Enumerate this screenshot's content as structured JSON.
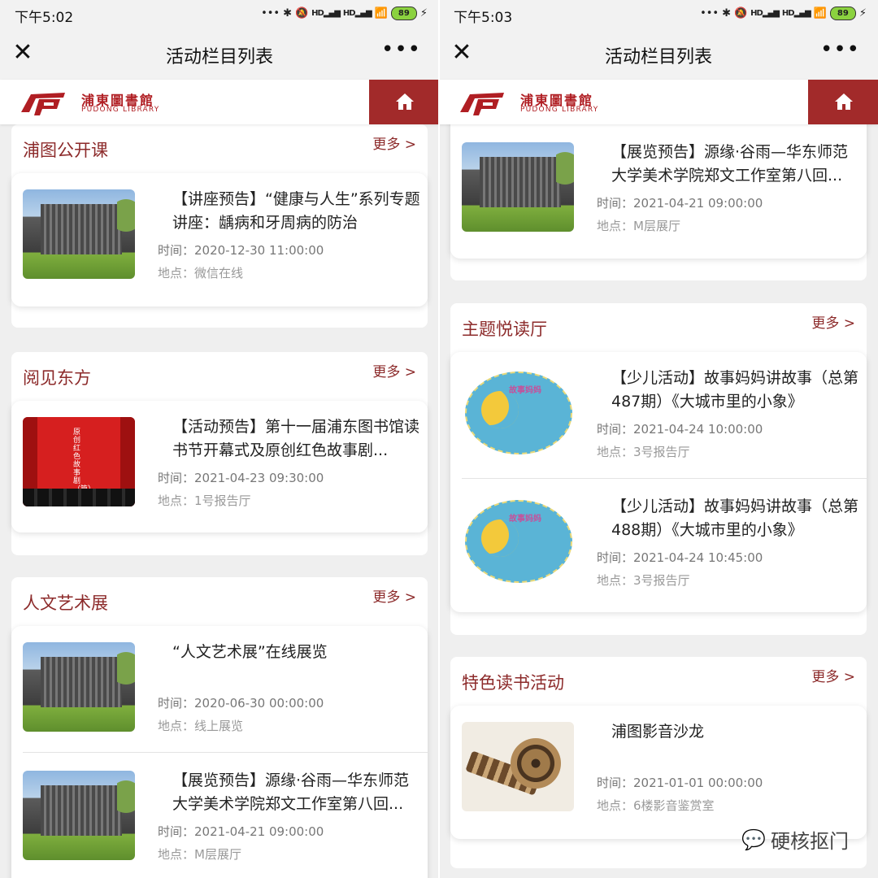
{
  "left": {
    "status": {
      "time": "下午5:02",
      "battery": "89"
    },
    "title": "活动栏目列表",
    "logo_cn": "浦東圖書館",
    "logo_en": "PUDONG LIBRARY",
    "sections": [
      {
        "title": "浦图公开课",
        "more": "更多 >",
        "items": [
          {
            "title": "【讲座预告】“健康与人生”系列专题讲座：龋病和牙周病的防治",
            "time": "时间：2020-12-30 11:00:00",
            "place": "地点：微信在线",
            "thumb": "building"
          }
        ]
      },
      {
        "title": "阅见东方",
        "more": "更多 >",
        "items": [
          {
            "title": "【活动预告】第十一届浦东图书馆读书节开幕式及原创红色故事剧...",
            "time": "时间：2021-04-23 09:30:00",
            "place": "地点：1号报告厅",
            "thumb": "theater"
          }
        ]
      },
      {
        "title": "人文艺术展",
        "more": "更多 >",
        "items": [
          {
            "title": "“人文艺术展”在线展览",
            "time": "时间：2020-06-30 00:00:00",
            "place": "地点：线上展览",
            "thumb": "building"
          },
          {
            "title": "【展览预告】源缘·谷雨—华东师范大学美术学院郑文工作室第八回...",
            "time": "时间：2021-04-21 09:00:00",
            "place": "地点：M层展厅",
            "thumb": "building"
          }
        ]
      }
    ]
  },
  "right": {
    "status": {
      "time": "下午5:03",
      "battery": "89"
    },
    "title": "活动栏目列表",
    "logo_cn": "浦東圖書館",
    "logo_en": "PUDONG LIBRARY",
    "partial_item": {
      "title": "【展览预告】源缘·谷雨—华东师范大学美术学院郑文工作室第八回...",
      "time": "时间：2021-04-21 09:00:00",
      "place": "地点：M层展厅",
      "thumb": "building"
    },
    "sections": [
      {
        "title": "主题悦读厅",
        "more": "更多 >",
        "items": [
          {
            "title": "【少儿活动】故事妈妈讲故事（总第487期）《大城市里的小象》",
            "time": "时间：2021-04-24 10:00:00",
            "place": "地点：3号报告厅",
            "thumb": "story"
          },
          {
            "title": "【少儿活动】故事妈妈讲故事（总第488期）《大城市里的小象》",
            "time": "时间：2021-04-24 10:45:00",
            "place": "地点：3号报告厅",
            "thumb": "story"
          }
        ]
      },
      {
        "title": "特色读书活动",
        "more": "更多 >",
        "items": [
          {
            "title": "浦图影音沙龙",
            "time": "时间：2021-01-01 00:00:00",
            "place": "地点：6楼影音鉴赏室",
            "thumb": "film"
          }
        ]
      }
    ]
  },
  "thumb_text": {
    "theater": "原创红色故事剧（篇）",
    "story": "故事妈妈"
  },
  "watermark": "硬核抠门"
}
